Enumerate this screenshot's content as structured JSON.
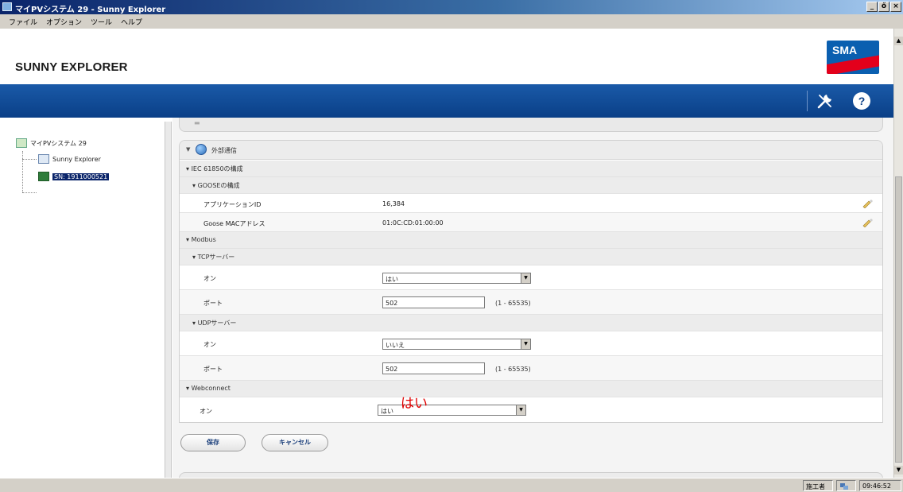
{
  "window": {
    "title": "マイPVシステム 29 - Sunny Explorer",
    "controls": [
      "_",
      "ő",
      "×"
    ]
  },
  "menu": [
    "ファイル",
    "オプション",
    "ツール",
    "ヘルプ"
  ],
  "header": {
    "brand": "SUNNY EXPLORER",
    "logo_text": "SMA"
  },
  "toolbar": {
    "settings_icon": "wrench-icon",
    "help_icon": "help-icon",
    "help_symbol": "?"
  },
  "tree": {
    "root": "マイPVシステム 29",
    "children": [
      {
        "label": "Sunny Explorer",
        "icon": "screen-icon"
      },
      {
        "label": "SN: 1911000521",
        "icon": "inverter-icon",
        "selected": true
      }
    ]
  },
  "section": {
    "title": "外部通信",
    "groups": {
      "iec": "IEC 61850の構成",
      "goose": "GOOSEの構成",
      "modbus": "Modbus",
      "tcp": "TCPサーバー",
      "udp": "UDPサーバー",
      "webconnect": "Webconnect"
    },
    "fields": {
      "app_id_label": "アプリケーションID",
      "app_id_value": "16,384",
      "goose_mac_label": "Goose MACアドレス",
      "goose_mac_value": "01:0C:CD:01:00:00",
      "tcp_on_label": "オン",
      "tcp_on_value": "はい",
      "tcp_port_label": "ポート",
      "tcp_port_value": "502",
      "tcp_port_range": "(1 - 65535)",
      "udp_on_label": "オン",
      "udp_on_value": "いいえ",
      "udp_port_label": "ポート",
      "udp_port_value": "502",
      "udp_port_range": "(1 - 65535)",
      "web_on_label": "オン",
      "web_on_value": "はい"
    },
    "annotation": "はい"
  },
  "buttons": {
    "save": "保存",
    "cancel": "キャンセル"
  },
  "statusbar": {
    "user": "施工者",
    "time": "09:46:52"
  }
}
